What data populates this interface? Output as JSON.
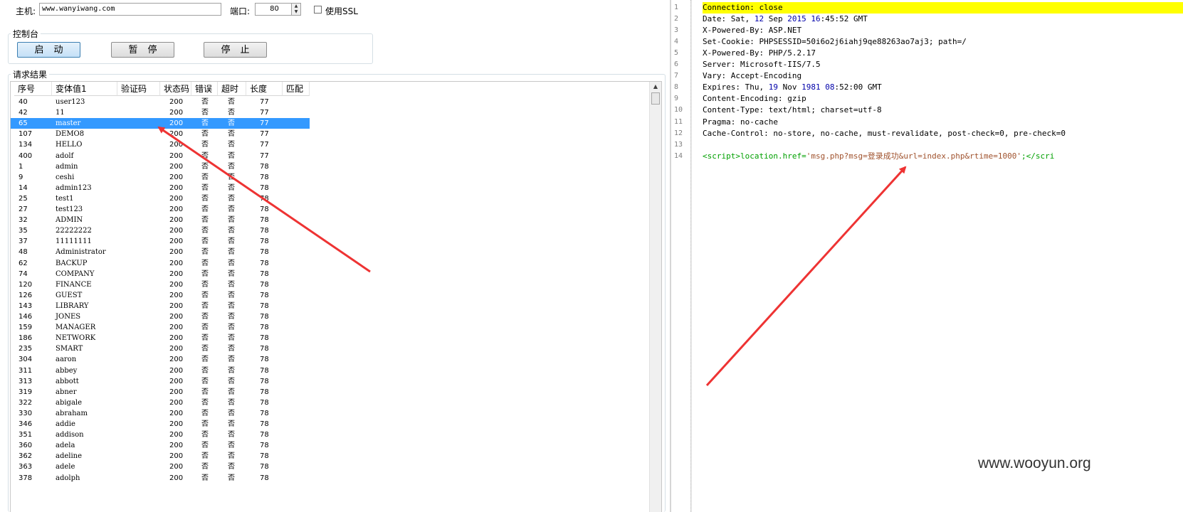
{
  "connection": {
    "host_label": "主机:",
    "host_value": "www.wanyiwang.com",
    "port_label": "端口:",
    "port_value": "80",
    "ssl_label": "使用SSL"
  },
  "console": {
    "title": "控制台",
    "start_label": "启动",
    "pause_label": "暂停",
    "stop_label": "停止"
  },
  "results": {
    "title": "请求结果",
    "columns": [
      "序号",
      "变体值1",
      "验证码",
      "状态码",
      "错误",
      "超时",
      "长度",
      "匹配"
    ],
    "rows": [
      [
        "40",
        "user123",
        "",
        "200",
        "否",
        "否",
        "77"
      ],
      [
        "42",
        "11",
        "",
        "200",
        "否",
        "否",
        "77"
      ],
      [
        "65",
        "master",
        "",
        "200",
        "否",
        "否",
        "77"
      ],
      [
        "107",
        "DEMO8",
        "",
        "200",
        "否",
        "否",
        "77"
      ],
      [
        "134",
        "HELLO",
        "",
        "200",
        "否",
        "否",
        "77"
      ],
      [
        "400",
        "adolf",
        "",
        "200",
        "否",
        "否",
        "77"
      ],
      [
        "1",
        "admin",
        "",
        "200",
        "否",
        "否",
        "78"
      ],
      [
        "9",
        "ceshi",
        "",
        "200",
        "否",
        "否",
        "78"
      ],
      [
        "14",
        "admin123",
        "",
        "200",
        "否",
        "否",
        "78"
      ],
      [
        "25",
        "test1",
        "",
        "200",
        "否",
        "否",
        "78"
      ],
      [
        "27",
        "test123",
        "",
        "200",
        "否",
        "否",
        "78"
      ],
      [
        "32",
        "ADMIN",
        "",
        "200",
        "否",
        "否",
        "78"
      ],
      [
        "35",
        "22222222",
        "",
        "200",
        "否",
        "否",
        "78"
      ],
      [
        "37",
        "11111111",
        "",
        "200",
        "否",
        "否",
        "78"
      ],
      [
        "48",
        "Administrator",
        "",
        "200",
        "否",
        "否",
        "78"
      ],
      [
        "62",
        "BACKUP",
        "",
        "200",
        "否",
        "否",
        "78"
      ],
      [
        "74",
        "COMPANY",
        "",
        "200",
        "否",
        "否",
        "78"
      ],
      [
        "120",
        "FINANCE",
        "",
        "200",
        "否",
        "否",
        "78"
      ],
      [
        "126",
        "GUEST",
        "",
        "200",
        "否",
        "否",
        "78"
      ],
      [
        "143",
        "LIBRARY",
        "",
        "200",
        "否",
        "否",
        "78"
      ],
      [
        "146",
        "JONES",
        "",
        "200",
        "否",
        "否",
        "78"
      ],
      [
        "159",
        "MANAGER",
        "",
        "200",
        "否",
        "否",
        "78"
      ],
      [
        "186",
        "NETWORK",
        "",
        "200",
        "否",
        "否",
        "78"
      ],
      [
        "235",
        "SMART",
        "",
        "200",
        "否",
        "否",
        "78"
      ],
      [
        "304",
        "aaron",
        "",
        "200",
        "否",
        "否",
        "78"
      ],
      [
        "311",
        "abbey",
        "",
        "200",
        "否",
        "否",
        "78"
      ],
      [
        "313",
        "abbott",
        "",
        "200",
        "否",
        "否",
        "78"
      ],
      [
        "319",
        "abner",
        "",
        "200",
        "否",
        "否",
        "78"
      ],
      [
        "322",
        "abigale",
        "",
        "200",
        "否",
        "否",
        "78"
      ],
      [
        "330",
        "abraham",
        "",
        "200",
        "否",
        "否",
        "78"
      ],
      [
        "346",
        "addie",
        "",
        "200",
        "否",
        "否",
        "78"
      ],
      [
        "351",
        "addison",
        "",
        "200",
        "否",
        "否",
        "78"
      ],
      [
        "360",
        "adela",
        "",
        "200",
        "否",
        "否",
        "78"
      ],
      [
        "362",
        "adeline",
        "",
        "200",
        "否",
        "否",
        "78"
      ],
      [
        "363",
        "adele",
        "",
        "200",
        "否",
        "否",
        "78"
      ],
      [
        "378",
        "adolph",
        "",
        "200",
        "否",
        "否",
        "78"
      ]
    ],
    "selected_index": 2
  },
  "response": {
    "lines": [
      [
        {
          "t": "Connection: close",
          "c": "hl"
        }
      ],
      [
        {
          "t": "Date: Sat, "
        },
        {
          "t": "12",
          "c": "num"
        },
        {
          "t": " Sep "
        },
        {
          "t": "2015",
          "c": "num"
        },
        {
          "t": " "
        },
        {
          "t": "16",
          "c": "num"
        },
        {
          "t": ":45:52 GMT"
        }
      ],
      [
        {
          "t": "X-Powered-By: ASP.NET"
        }
      ],
      [
        {
          "t": "Set-Cookie: PHPSESSID=50i6o2j6iahj9qe88263ao7aj3; path=/"
        }
      ],
      [
        {
          "t": "X-Powered-By: PHP/5.2.17"
        }
      ],
      [
        {
          "t": "Server: Microsoft-IIS/7.5"
        }
      ],
      [
        {
          "t": "Vary: Accept-Encoding"
        }
      ],
      [
        {
          "t": "Expires: Thu, "
        },
        {
          "t": "19",
          "c": "num"
        },
        {
          "t": " Nov "
        },
        {
          "t": "1981",
          "c": "num"
        },
        {
          "t": " "
        },
        {
          "t": "08",
          "c": "num"
        },
        {
          "t": ":52:00 GMT"
        }
      ],
      [
        {
          "t": "Content-Encoding: gzip"
        }
      ],
      [
        {
          "t": "Content-Type: text/html; charset=utf-8"
        }
      ],
      [
        {
          "t": "Pragma: no-cache"
        }
      ],
      [
        {
          "t": "Cache-Control: no-store, no-cache, must-revalidate, post-check=0, pre-check=0"
        }
      ],
      [],
      [
        {
          "t": " <script>",
          "c": "tag"
        },
        {
          "t": "location.href=",
          "c": "tag"
        },
        {
          "t": "'msg.php?msg=登录成功&url=index.php&rtime=1000'",
          "c": "str"
        },
        {
          "t": ";</scri",
          "c": "tag"
        }
      ]
    ]
  },
  "watermark": "www.wooyun.org",
  "colors": {
    "selection": "#3399ff",
    "highlight": "#ffff00",
    "arrow": "#ee3333"
  },
  "icons": {
    "spin_up": "▲",
    "spin_down": "▼",
    "scroll_up": "▲"
  }
}
